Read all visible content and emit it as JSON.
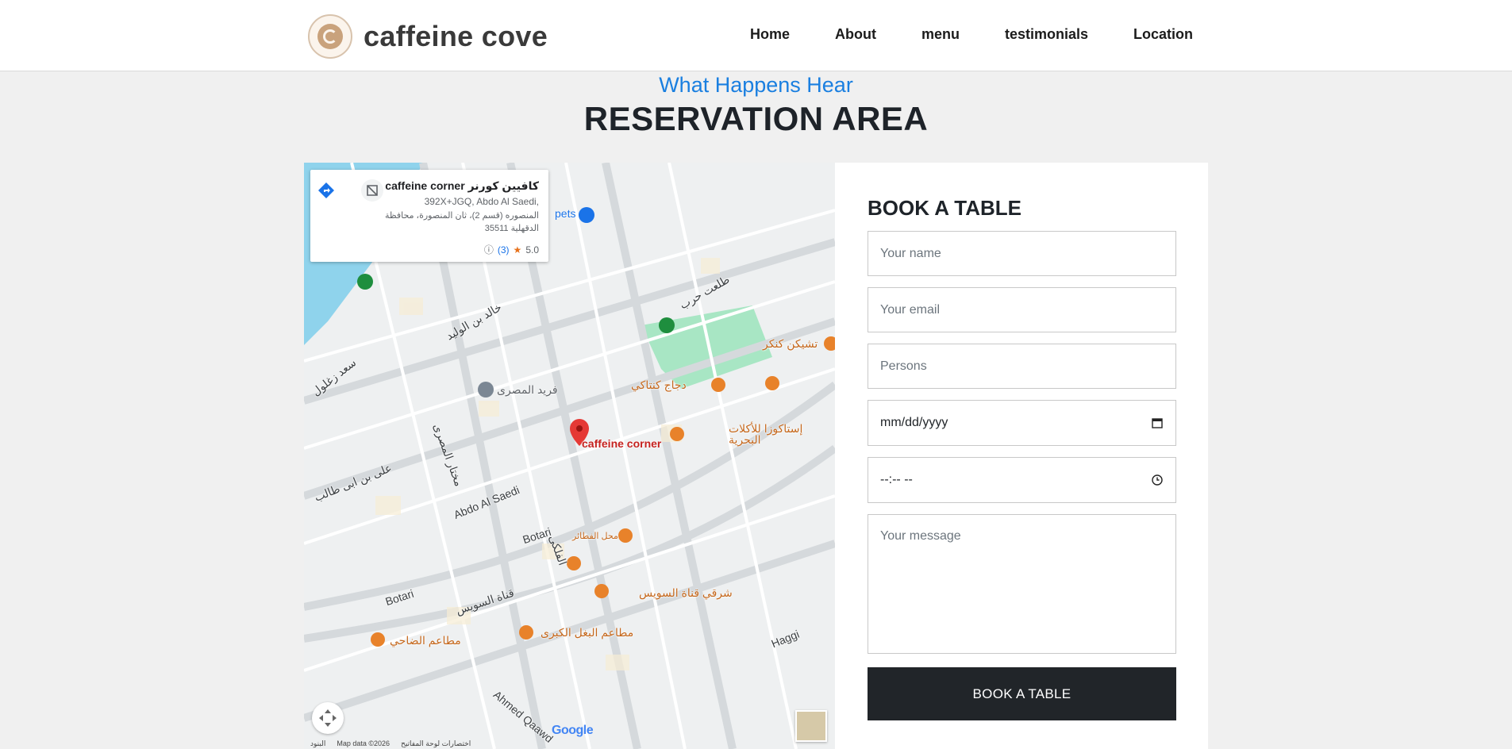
{
  "brand": {
    "name": "caffeine cove",
    "logo_icon": "coffee-cup-icon"
  },
  "nav": {
    "items": [
      {
        "label": "Home"
      },
      {
        "label": "About"
      },
      {
        "label": "menu"
      },
      {
        "label": "testimonials"
      },
      {
        "label": "Location"
      }
    ]
  },
  "section": {
    "subtitle": "What Happens Hear",
    "title": "RESERVATION AREA"
  },
  "map": {
    "place_card": {
      "name": "caffeine corner كافيين كورنر",
      "address_line1": "392X+JGQ, Abdo Al Saedi,",
      "address_line2": "المنصوره (قسم 2)، ثان المنصورة، محافظة الدقهلية 35511",
      "rating": "5.0",
      "review_count": "(3)"
    },
    "pin_label": "caffeine corner",
    "streets": [
      "Abdo Al Saedi",
      "Botari",
      "Botari",
      "Haggi",
      "Ahmed Qaawd",
      "طلعت حرب",
      "خالد بن الوليد",
      "على بن ابى طالب",
      "الفلكى",
      "قناة السويس",
      "سعد زغلول",
      "مختار المصرى"
    ],
    "places": [
      "pets",
      "فريد المصرى",
      "دجاج كنتاكي",
      "تشيكن كنكر",
      "إستاكوزا للأكلات البحرية",
      "محل الفطائر",
      "شرقي قناة السويس",
      "مطاعم البغل الكبرى",
      "مطاعم الضاحي"
    ],
    "footer": [
      "البنود",
      "Map data ©2026",
      "اختصارات لوحة المفاتيح"
    ],
    "google_logo": "Google",
    "colors": {
      "water": "#8fd3ec",
      "park": "#a8e6c4",
      "pin": "#e53935",
      "poi": "#e8822a"
    }
  },
  "form": {
    "title": "BOOK A TABLE",
    "name_placeholder": "Your name",
    "email_placeholder": "Your email",
    "persons_placeholder": "Persons",
    "date_value": "mm/dd/yyyy",
    "time_value": "--:-- --",
    "message_placeholder": "Your message",
    "submit_label": "BOOK A TABLE"
  },
  "colors": {
    "accent": "#1a7fe0",
    "button": "#212529",
    "background": "#f0f0f0"
  }
}
